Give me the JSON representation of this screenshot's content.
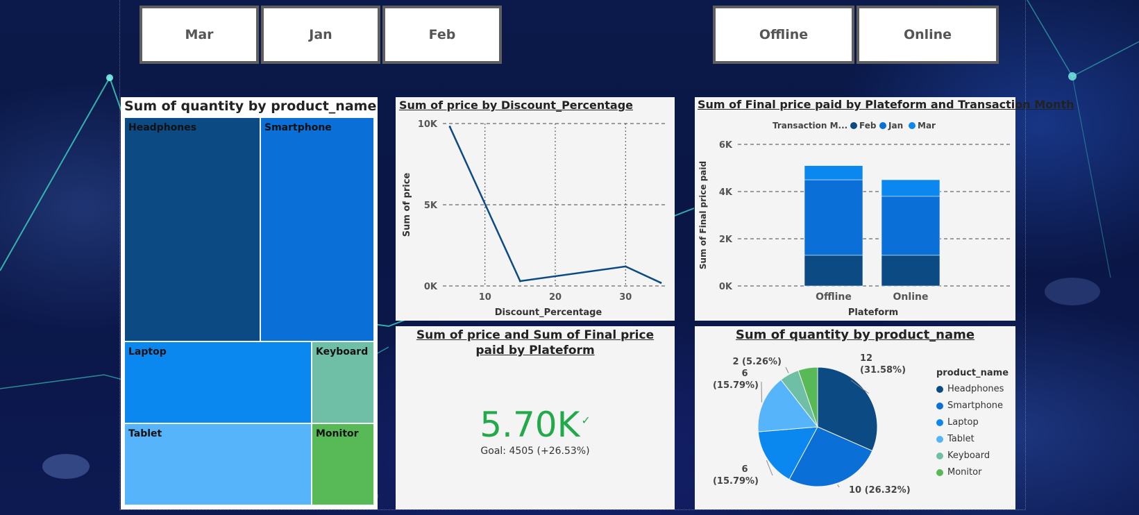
{
  "slicers": {
    "months": [
      "Mar",
      "Jan",
      "Feb"
    ],
    "platforms": [
      "Offline",
      "Online"
    ]
  },
  "colors": {
    "headphones": "#0c4a84",
    "smartphone": "#0a6fd6",
    "laptop": "#0b88f0",
    "tablet": "#56b4fb",
    "keyboard": "#6fbfa6",
    "monitor": "#58b957",
    "kpi_green": "#22a94a",
    "line": "#0c4a84"
  },
  "treemap": {
    "title": "Sum of quantity by product_name",
    "items": [
      {
        "name": "Headphones",
        "value": 12
      },
      {
        "name": "Smartphone",
        "value": 10
      },
      {
        "name": "Laptop",
        "value": 6
      },
      {
        "name": "Keyboard",
        "value": 2
      },
      {
        "name": "Tablet",
        "value": 6
      },
      {
        "name": "Monitor",
        "value": 2
      }
    ]
  },
  "kpi": {
    "title": "Sum of price and Sum of Final price paid by Plateform",
    "value": "5.70K",
    "goal": "Goal: 4505 (+26.53%)"
  },
  "chart_data": [
    {
      "type": "line",
      "title": "Sum of price by Discount_Percentage",
      "xlabel": "Discount_Percentage",
      "ylabel": "Sum of price",
      "x": [
        5,
        15,
        30,
        35
      ],
      "y": [
        9800,
        300,
        1200,
        200
      ],
      "xlim": [
        4,
        36
      ],
      "ylim": [
        0,
        10000
      ],
      "xticks": [
        10,
        20,
        30
      ],
      "yticks": [
        0,
        5000,
        10000
      ],
      "ytick_labels": [
        "0K",
        "5K",
        "10K"
      ],
      "grid": true
    },
    {
      "type": "bar",
      "stacked": true,
      "title": "Sum of Final price paid by Plateform and Transaction Month",
      "xlabel": "Plateform",
      "ylabel": "Sum of Final price paid",
      "legend_title": "Transaction M...",
      "categories": [
        "Offline",
        "Online"
      ],
      "series": [
        {
          "name": "Feb",
          "color": "#0c4a84",
          "values": [
            1300,
            1300
          ]
        },
        {
          "name": "Jan",
          "color": "#0a6fd6",
          "values": [
            3200,
            2500
          ]
        },
        {
          "name": "Mar",
          "color": "#0b88f0",
          "values": [
            600,
            700
          ]
        }
      ],
      "ylim": [
        0,
        6000
      ],
      "yticks": [
        0,
        2000,
        4000,
        6000
      ],
      "ytick_labels": [
        "0K",
        "2K",
        "4K",
        "6K"
      ],
      "legend": "top"
    },
    {
      "type": "pie",
      "title": "Sum of quantity by product_name",
      "legend_title": "product_name",
      "slices": [
        {
          "name": "Headphones",
          "value": 12,
          "label": "12 (31.58%)",
          "color": "#0c4a84"
        },
        {
          "name": "Smartphone",
          "value": 10,
          "label": "10 (26.32%)",
          "color": "#0a6fd6"
        },
        {
          "name": "Laptop",
          "value": 6,
          "label": "6 (15.79%)",
          "color": "#0b88f0"
        },
        {
          "name": "Tablet",
          "value": 6,
          "label": "6 (15.79%)",
          "color": "#56b4fb"
        },
        {
          "name": "Keyboard",
          "value": 2,
          "label": "2 (5.26%)",
          "color": "#6fbfa6"
        },
        {
          "name": "Monitor",
          "value": 2,
          "label": "",
          "color": "#58b957"
        }
      ],
      "legend": "right"
    }
  ]
}
